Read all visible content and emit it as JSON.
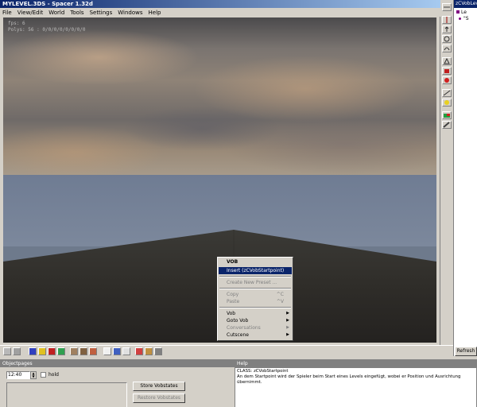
{
  "window": {
    "title": "MYLEVEL.3DS - Spacer 1.32d"
  },
  "menu": [
    "File",
    "View/Edit",
    "World",
    "Tools",
    "Settings",
    "Windows",
    "Help"
  ],
  "viewport": {
    "hud_line1": "fps: 6",
    "hud_line2": "Polys: 56 : 0/0/0/0/0/0/0/0"
  },
  "context_menu": {
    "header": "VOB",
    "insert": "Insert (zCVobStartpoint)",
    "create_preset": "Create New Preset ...",
    "copy": "Copy",
    "copy_shortcut": "^C",
    "paste": "Paste",
    "paste_shortcut": "^V",
    "vob": "Vob",
    "goto_vob": "Goto Vob",
    "conversations": "Conversations",
    "cutscene": "Cutscene"
  },
  "right_panel": {
    "title": "zCVobLevelCompo",
    "tree_item1": "Le",
    "tree_item2": "\"S",
    "refresh_label": "Refresh"
  },
  "objectpages": {
    "title": "Objectpages",
    "time_value": "12:40",
    "hold_label": "hold",
    "store_label": "Store Vobstates",
    "restore_label": "Restore Vobstates"
  },
  "help": {
    "title": "Help",
    "class_line": "CLASS: zCVobStartpoint",
    "description": "An dem Startpoint wird der Spieler beim Start eines Levels eingefügt, wobei er Position und Ausrichtung übernimmt."
  },
  "colors": {
    "title_active": "#0a246a",
    "menu_highlight": "#0a246a",
    "window_bg": "#d4d0c8"
  }
}
